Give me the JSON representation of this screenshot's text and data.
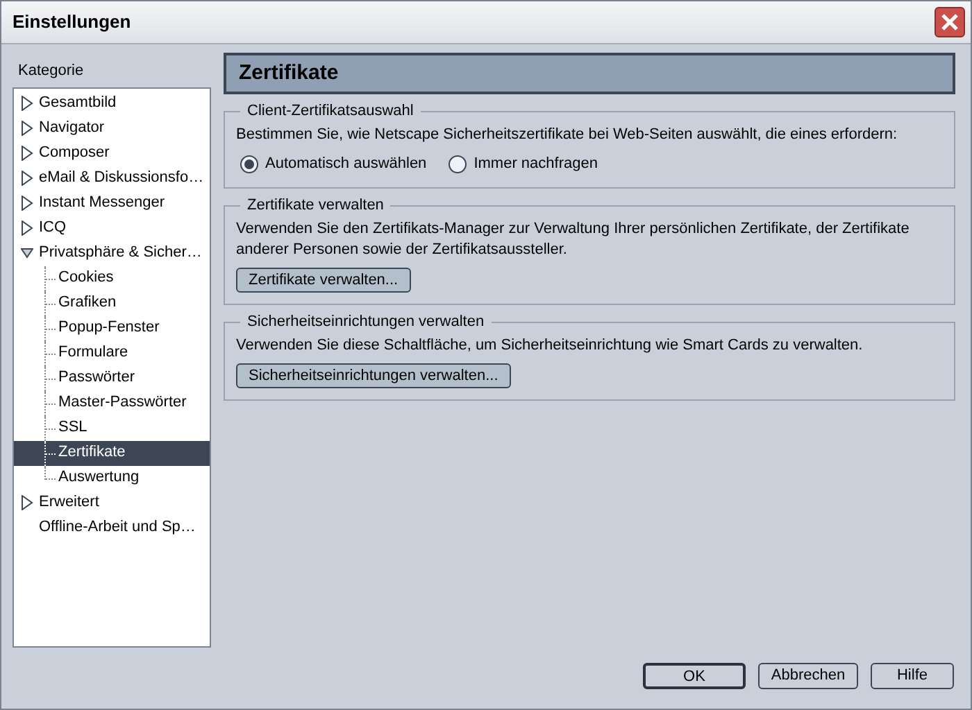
{
  "window": {
    "title": "Einstellungen"
  },
  "sidebar": {
    "label": "Kategorie",
    "items": [
      {
        "label": "Gesamtbild",
        "kind": "folder",
        "expanded": false,
        "selected": false
      },
      {
        "label": "Navigator",
        "kind": "folder",
        "expanded": false,
        "selected": false
      },
      {
        "label": "Composer",
        "kind": "folder",
        "expanded": false,
        "selected": false
      },
      {
        "label": "eMail & Diskussionsfo…",
        "kind": "folder",
        "expanded": false,
        "selected": false
      },
      {
        "label": "Instant Messenger",
        "kind": "folder",
        "expanded": false,
        "selected": false
      },
      {
        "label": "ICQ",
        "kind": "folder",
        "expanded": false,
        "selected": false
      },
      {
        "label": "Privatsphäre & Sicher…",
        "kind": "folder",
        "expanded": true,
        "selected": false,
        "children": [
          {
            "label": "Cookies",
            "selected": false
          },
          {
            "label": "Grafiken",
            "selected": false
          },
          {
            "label": "Popup-Fenster",
            "selected": false
          },
          {
            "label": "Formulare",
            "selected": false
          },
          {
            "label": "Passwörter",
            "selected": false
          },
          {
            "label": "Master-Passwörter",
            "selected": false
          },
          {
            "label": "SSL",
            "selected": false
          },
          {
            "label": "Zertifikate",
            "selected": true
          },
          {
            "label": "Auswertung",
            "selected": false
          }
        ]
      },
      {
        "label": "Erweitert",
        "kind": "folder",
        "expanded": false,
        "selected": false
      },
      {
        "label": "Offline-Arbeit und Sp…",
        "kind": "leaf",
        "selected": false
      }
    ]
  },
  "panel": {
    "title": "Zertifikate",
    "groups": [
      {
        "legend": "Client-Zertifikatsauswahl",
        "text": "Bestimmen Sie, wie Netscape Sicherheitszertifikate bei Web-Seiten auswählt, die eines erfordern:",
        "kind": "radio",
        "options": [
          {
            "label": "Automatisch auswählen",
            "selected": true
          },
          {
            "label": "Immer nachfragen",
            "selected": false
          }
        ]
      },
      {
        "legend": "Zertifikate verwalten",
        "text": "Verwenden Sie den Zertifikats-Manager zur Verwaltung Ihrer persönlichen Zertifikate, der Zertifikate anderer Personen sowie der Zertifikatsaussteller.",
        "kind": "button",
        "button": "Zertifikate verwalten..."
      },
      {
        "legend": "Sicherheitseinrichtungen verwalten",
        "text": "Verwenden Sie diese Schaltfläche, um Sicherheitseinrichtung wie Smart Cards zu verwalten.",
        "kind": "button",
        "button": "Sicherheitseinrichtungen verwalten..."
      }
    ]
  },
  "buttons": [
    {
      "label": "OK",
      "default": true
    },
    {
      "label": "Abbrechen",
      "default": false
    },
    {
      "label": "Hilfe",
      "default": false
    }
  ]
}
